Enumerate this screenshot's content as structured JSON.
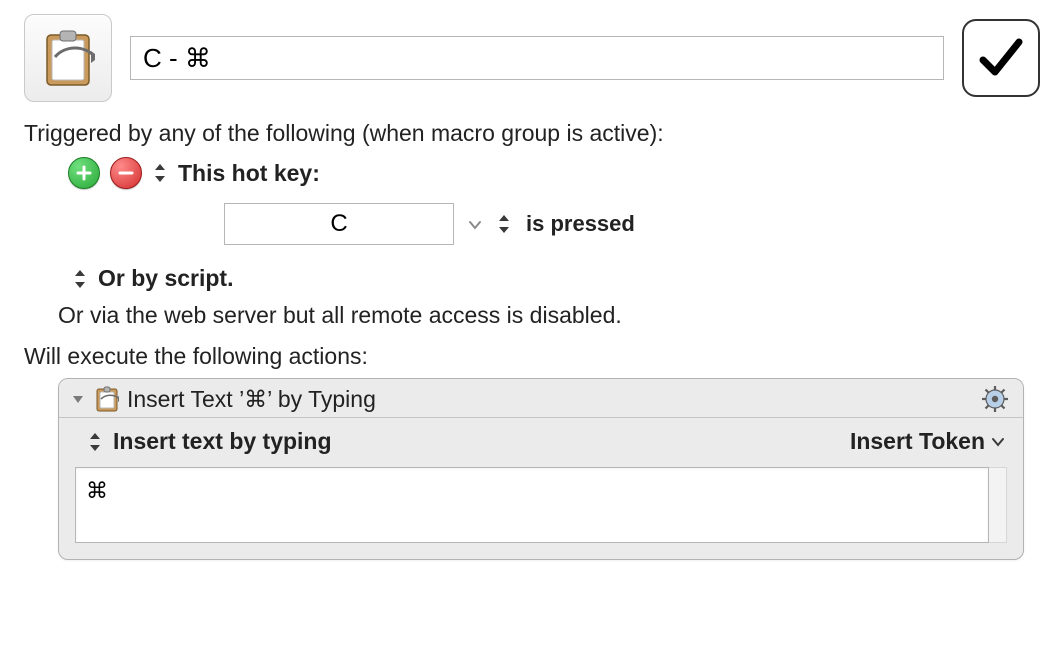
{
  "macro": {
    "name": "C - ⌘",
    "enabled": true,
    "icon": "clipboard-icon"
  },
  "triggers": {
    "section_label": "Triggered by any of the following (when macro group is active):",
    "hotkey": {
      "label": "This hot key:",
      "key": "C",
      "state_label": "is pressed"
    },
    "or_script_label": "Or by script.",
    "or_via_label": "Or via the web server but all remote access is disabled."
  },
  "actions": {
    "section_label": "Will execute the following actions:",
    "items": [
      {
        "title": "Insert Text ’⌘’ by Typing",
        "method_label": "Insert text by typing",
        "token_label": "Insert Token",
        "text": "⌘"
      }
    ]
  }
}
